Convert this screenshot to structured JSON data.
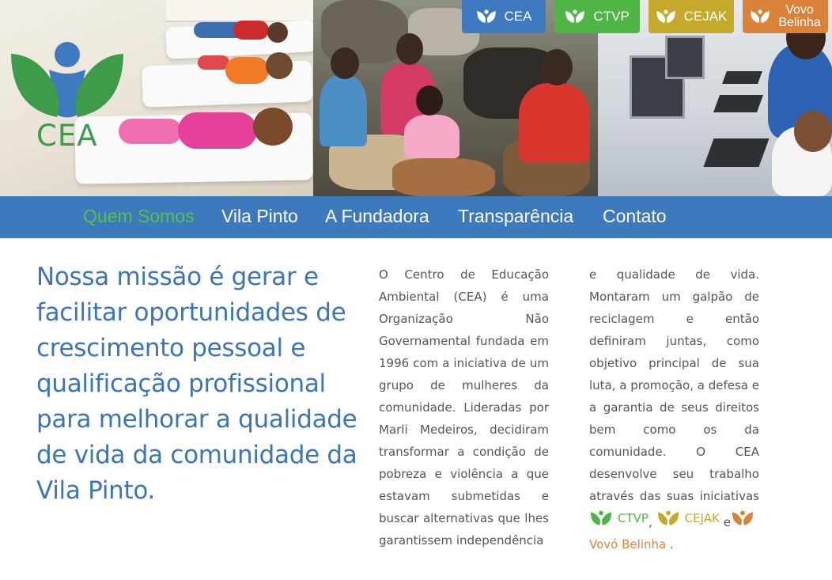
{
  "logo": {
    "text": "CEA"
  },
  "top_tabs": [
    {
      "label": "CEA",
      "color": "#3f7ac0"
    },
    {
      "label": "CTVP",
      "color": "#4fb545"
    },
    {
      "label": "CEJAK",
      "color": "#c4a92a"
    },
    {
      "label_line1": "Vovo",
      "label_line2": "Belinha",
      "color": "#d9823a"
    }
  ],
  "nav": {
    "items": [
      {
        "label": "Quem Somos",
        "active": true
      },
      {
        "label": "Vila Pinto"
      },
      {
        "label": "A Fundadora"
      },
      {
        "label": "Transparência"
      },
      {
        "label": "Contato"
      }
    ]
  },
  "mission": "Nossa missão é gerar e facilitar oportunidades de crescimento pessoal e qualificação profissional para melhorar a qualidade de vida da comunidade da Vila Pinto.",
  "body": {
    "col1": "O Centro de Educação Ambiental (CEA) é uma Organização Não Governamental fundada em 1996 com a iniciativa de um grupo de mulheres da comunidade. Lideradas por Marli Medeiros, decidiram transformar a condição de pobreza e violência a que estavam submetidas e buscar alternativas que lhes garantissem independência",
    "col2": "e qualidade de vida. Montaram um galpão de reciclagem e então definiram juntas, como objetivo principal de sua luta, a promoção, a defesa e a garantia de seus direitos bem como os da comunidade. O CEA desenvolve seu trabalho através das suas iniciativas",
    "initiatives": {
      "ctvp": "CTVP",
      "cejak": "CEJAK",
      "vovo": "Vovó Belinha"
    },
    "sep_comma": ",",
    "sep_and": "e",
    "end_period": "."
  },
  "colors": {
    "nav_bg": "#3c79bd",
    "active": "#5cbf47",
    "mission": "#3a75b8"
  }
}
